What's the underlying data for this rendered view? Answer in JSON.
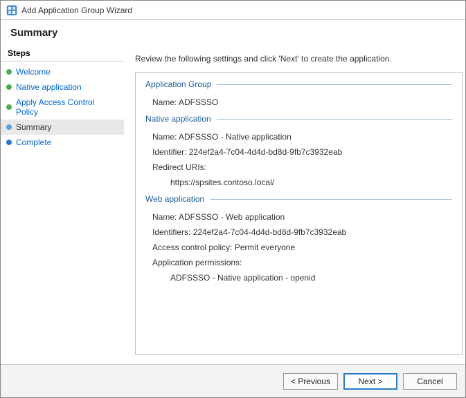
{
  "window": {
    "title": "Add Application Group Wizard"
  },
  "header": {
    "title": "Summary"
  },
  "sidebar": {
    "title": "Steps",
    "steps": [
      {
        "label": "Welcome"
      },
      {
        "label": "Native application"
      },
      {
        "label": "Apply Access Control Policy"
      },
      {
        "label": "Summary"
      },
      {
        "label": "Complete"
      }
    ]
  },
  "main": {
    "instruction": "Review the following settings and click 'Next' to create the application."
  },
  "summary": {
    "appGroup": {
      "header": "Application Group",
      "name_label": "Name:",
      "name_value": "ADFSSSO"
    },
    "nativeApp": {
      "header": "Native application",
      "name_label": "Name:",
      "name_value": "ADFSSSO - Native application",
      "identifier_label": "Identifier:",
      "identifier_value": "224ef2a4-7c04-4d4d-bd8d-9fb7c3932eab",
      "redirect_label": "Redirect URIs:",
      "redirect_value": "https://spsites.contoso.local/"
    },
    "webApp": {
      "header": "Web application",
      "name_label": "Name:",
      "name_value": "ADFSSSO - Web application",
      "identifiers_label": "Identifiers:",
      "identifiers_value": "224ef2a4-7c04-4d4d-bd8d-9fb7c3932eab",
      "acp_label": "Access control policy:",
      "acp_value": "Permit everyone",
      "perm_label": "Application permissions:",
      "perm_value": "ADFSSSO - Native application - openid"
    }
  },
  "footer": {
    "previous": "< Previous",
    "next": "Next >",
    "cancel": "Cancel"
  }
}
